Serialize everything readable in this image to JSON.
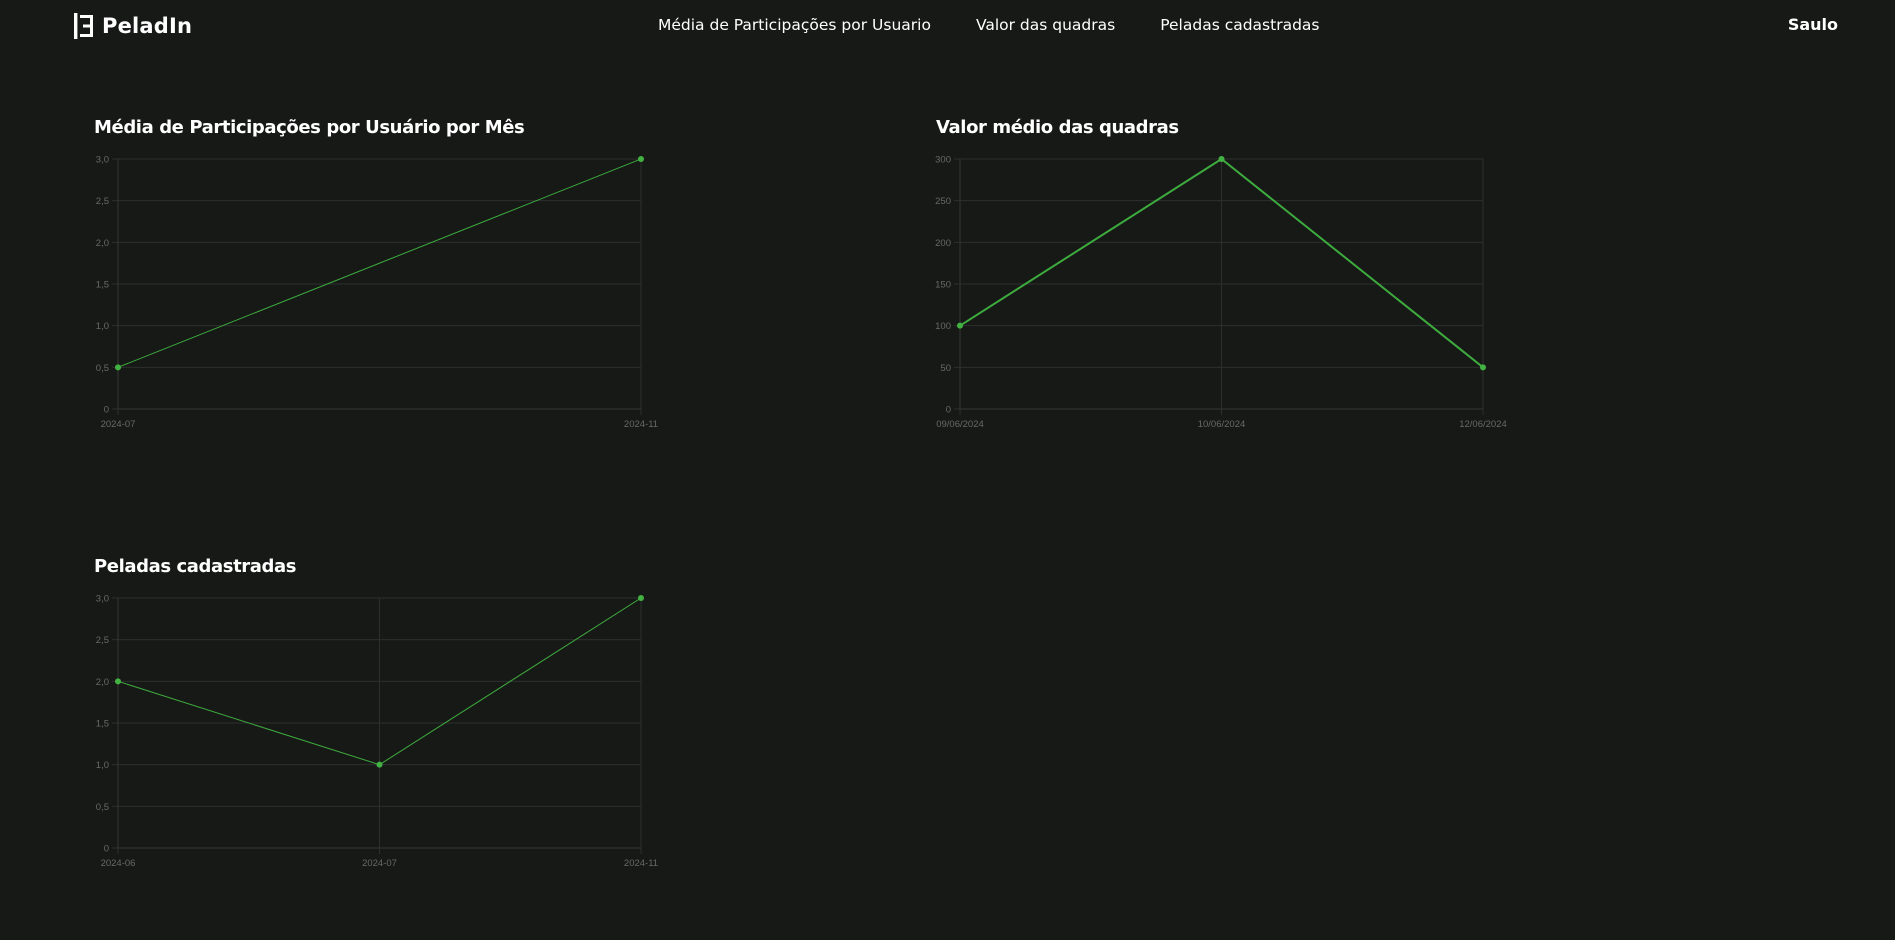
{
  "header": {
    "brand": "PeladIn",
    "nav": [
      "Média de Participações por Usuario",
      "Valor das quadras",
      "Peladas cadastradas"
    ],
    "user": "Saulo"
  },
  "colors": {
    "background": "#171917",
    "line": "#3dab3d",
    "point": "#42b342",
    "text": "#ffffff",
    "tick": "#666a66",
    "grid": "#2c2f2c"
  },
  "chart_data": [
    {
      "type": "line",
      "title": "Média de Participações por Usuário por Mês",
      "x": [
        "2024-07",
        "2024-11"
      ],
      "values": [
        0.5,
        3
      ],
      "ylim": [
        0,
        3
      ],
      "yticks": [
        "0",
        "0,5",
        "1,0",
        "1,5",
        "2,0",
        "2,5",
        "3,0"
      ],
      "grid": true,
      "line_width": "thin"
    },
    {
      "type": "line",
      "title": "Valor médio das quadras",
      "x": [
        "09/06/2024",
        "10/06/2024",
        "12/06/2024"
      ],
      "values": [
        100,
        300,
        50
      ],
      "ylim": [
        0,
        300
      ],
      "yticks": [
        "0",
        "50",
        "100",
        "150",
        "200",
        "250",
        "300"
      ],
      "grid": true,
      "line_width": "thick"
    },
    {
      "type": "line",
      "title": "Peladas cadastradas",
      "x": [
        "2024-06",
        "2024-07",
        "2024-11"
      ],
      "values": [
        2,
        1,
        3
      ],
      "ylim": [
        0,
        3
      ],
      "yticks": [
        "0",
        "0,5",
        "1,0",
        "1,5",
        "2,0",
        "2,5",
        "3,0"
      ],
      "grid": true,
      "line_width": "thin"
    }
  ]
}
